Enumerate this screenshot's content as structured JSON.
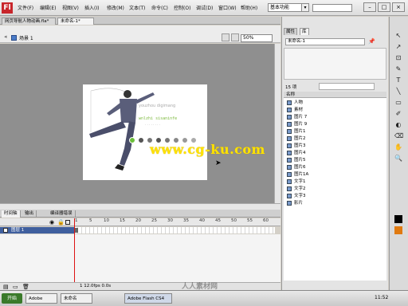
{
  "app": {
    "logo": "Fl",
    "menus": [
      "文件(F)",
      "编辑(E)",
      "视图(V)",
      "插入(I)",
      "修改(M)",
      "文本(T)",
      "命令(C)",
      "控制(O)",
      "调试(D)",
      "窗口(W)",
      "帮助(H)"
    ],
    "workspace": "基本功能",
    "window_buttons": [
      "–",
      "□",
      "×"
    ]
  },
  "doc_tabs": [
    "网页导航人物动画.fla*",
    "未命名-1*"
  ],
  "editbar": {
    "scene": "场景 1",
    "zoom": "50%"
  },
  "stage": {
    "watermark": "www.cg-ku.com",
    "nav_colors": [
      "#6bbf3a",
      "#555555",
      "#777777",
      "#555555",
      "#777777",
      "#888888",
      "#999999",
      "#aaaaaa"
    ]
  },
  "timeline": {
    "tabs": [
      "时间轴",
      "输出",
      "编译器错误"
    ],
    "ruler": [
      "1",
      "5",
      "10",
      "15",
      "20",
      "25",
      "30",
      "35",
      "40",
      "45",
      "50",
      "55",
      "60"
    ],
    "layer": "图层 1",
    "footer": "1 12.0fps 0.0s"
  },
  "right_panel": {
    "tabs": [
      "属性",
      "库"
    ],
    "library_doc": "未命名-1",
    "item_count": "15 项",
    "column_name": "名称",
    "items": [
      "人物",
      "素材",
      "图片 7",
      "图片 9",
      "图片1",
      "图片2",
      "图片3",
      "图片4",
      "图片5",
      "图片6",
      "图片1A",
      "文字1",
      "文字2",
      "文字3",
      "影片"
    ]
  },
  "tools": [
    "↖",
    "↗",
    "⊡",
    "✎",
    "T",
    "╲",
    "▭",
    "✐",
    "◐",
    "⌫",
    "✋",
    "🔍",
    "■",
    "□"
  ],
  "taskbar": {
    "start": "开始",
    "tasks": [
      "Adobe",
      "Adobe Flash CS4",
      "未命名"
    ],
    "clock": "11:52"
  },
  "overlay_watermark": "人人素材网"
}
